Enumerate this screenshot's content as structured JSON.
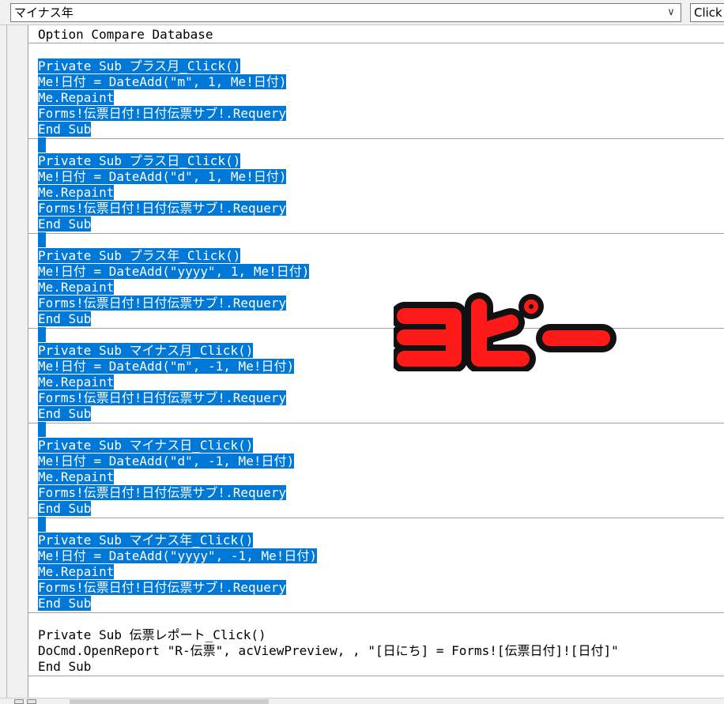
{
  "toolbar": {
    "object_combo_value": "マイナス年",
    "procedure_combo_value": "Click",
    "dropdown_glyph": "∨"
  },
  "code": {
    "header": "Option Compare Database",
    "procedures": [
      {
        "selected": true,
        "lines": [
          "Private Sub プラス月_Click()",
          "Me!日付 = DateAdd(\"m\", 1, Me!日付)",
          "Me.Repaint",
          "Forms!伝票日付!日付伝票サブ!.Requery",
          "End Sub"
        ]
      },
      {
        "selected": true,
        "lines": [
          "Private Sub プラス日_Click()",
          "Me!日付 = DateAdd(\"d\", 1, Me!日付)",
          "Me.Repaint",
          "Forms!伝票日付!日付伝票サブ!.Requery",
          "End Sub"
        ]
      },
      {
        "selected": true,
        "lines": [
          "Private Sub プラス年_Click()",
          "Me!日付 = DateAdd(\"yyyy\", 1, Me!日付)",
          "Me.Repaint",
          "Forms!伝票日付!日付伝票サブ!.Requery",
          "End Sub"
        ]
      },
      {
        "selected": true,
        "lines": [
          "Private Sub マイナス月_Click()",
          "Me!日付 = DateAdd(\"m\", -1, Me!日付)",
          "Me.Repaint",
          "Forms!伝票日付!日付伝票サブ!.Requery",
          "End Sub"
        ]
      },
      {
        "selected": true,
        "lines": [
          "Private Sub マイナス日_Click()",
          "Me!日付 = DateAdd(\"d\", -1, Me!日付)",
          "Me.Repaint",
          "Forms!伝票日付!日付伝票サブ!.Requery",
          "End Sub"
        ]
      },
      {
        "selected": true,
        "lines": [
          "Private Sub マイナス年_Click()",
          "Me!日付 = DateAdd(\"yyyy\", -1, Me!日付)",
          "Me.Repaint",
          "Forms!伝票日付!日付伝票サブ!.Requery",
          "End Sub"
        ]
      },
      {
        "selected": false,
        "lines": [
          "Private Sub 伝票レポート_Click()",
          "DoCmd.OpenReport \"R-伝票\", acViewPreview, , \"[日にち] = Forms![伝票日付]![日付]\"",
          "End Sub"
        ]
      }
    ]
  },
  "overlay": {
    "text": "コピー",
    "fill_color": "#ff1a1a",
    "outline_color": "#111111"
  },
  "colors": {
    "selection": "#0078d7",
    "editor_bg": "#ffffff",
    "chrome_bg": "#f0f0f0"
  }
}
